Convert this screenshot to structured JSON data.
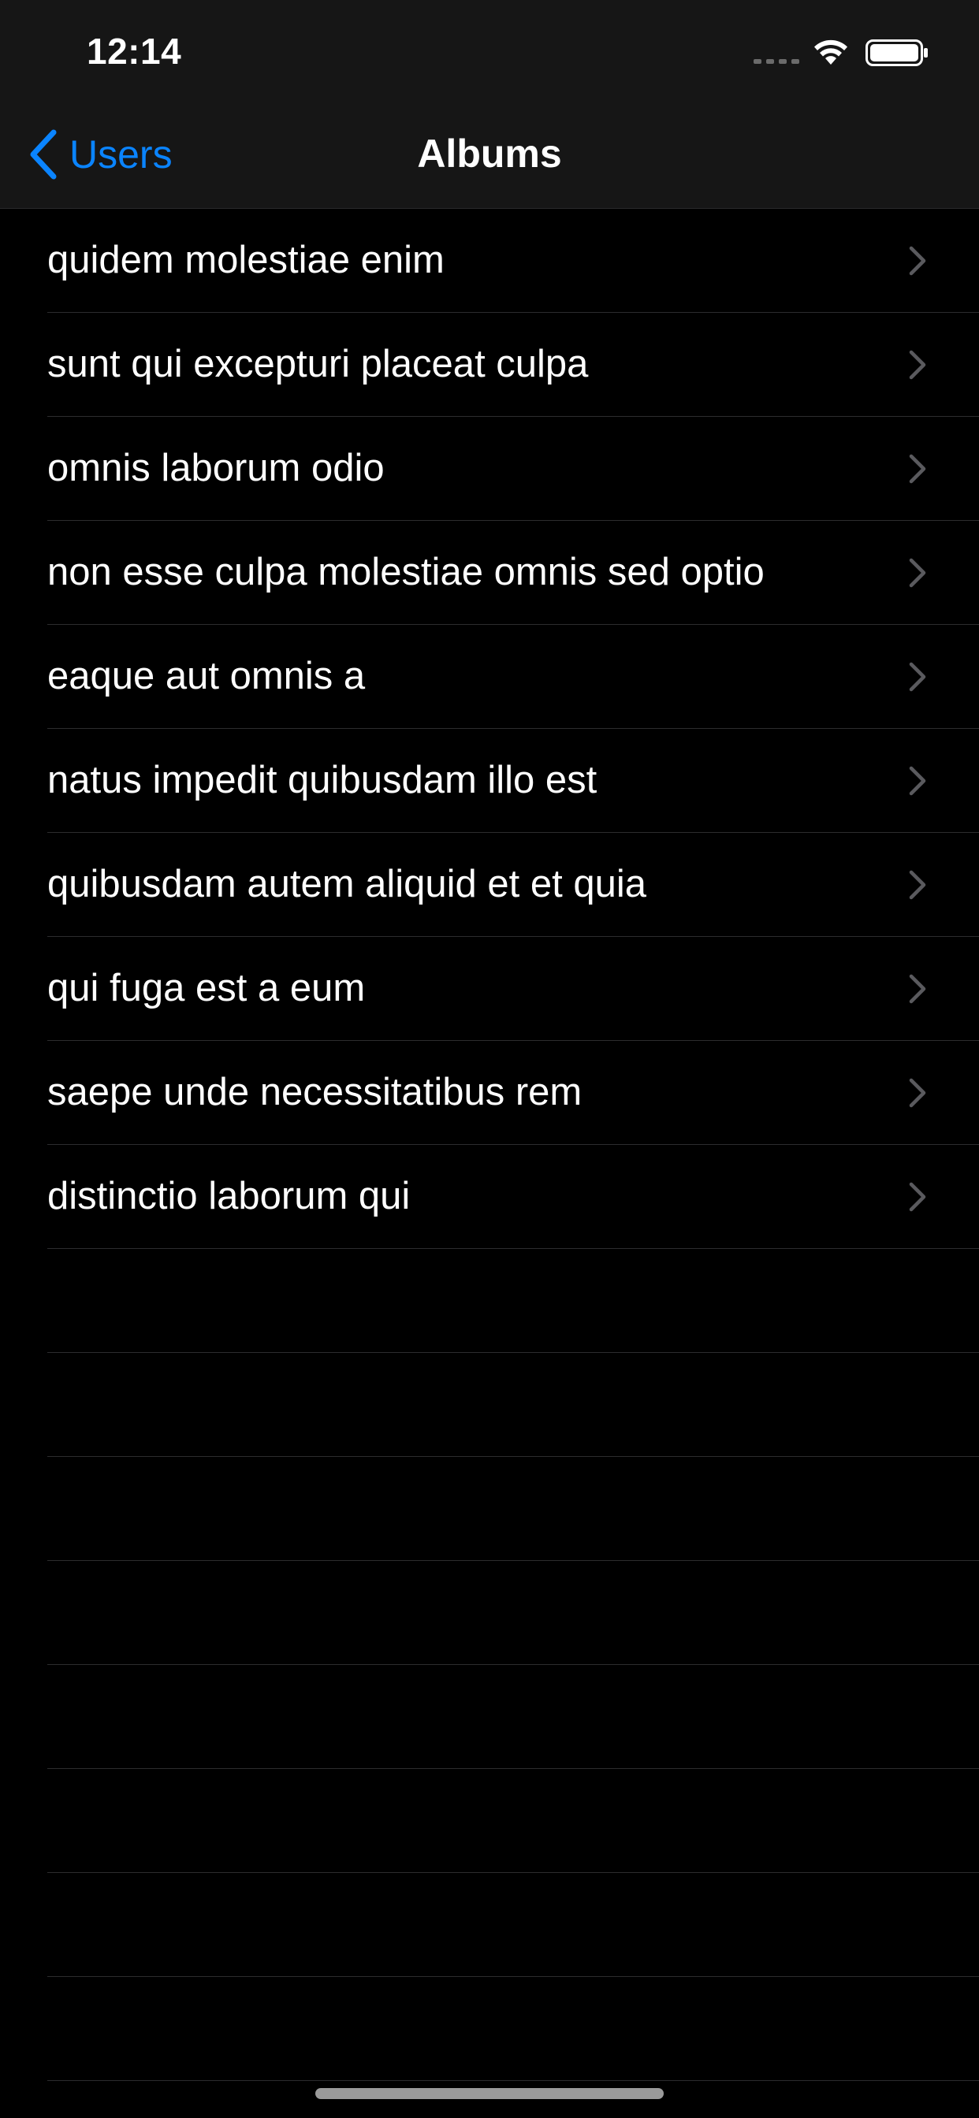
{
  "status_bar": {
    "time": "12:14"
  },
  "nav": {
    "back_label": "Users",
    "title": "Albums",
    "back_icon": "chevron-left-icon"
  },
  "colors": {
    "accent": "#0a84ff",
    "background": "#000000",
    "bar_background": "#161616",
    "separator": "#2c2c2e",
    "chevron": "#5a5a5e"
  },
  "albums": [
    {
      "title": "quidem molestiae enim"
    },
    {
      "title": "sunt qui excepturi placeat culpa"
    },
    {
      "title": "omnis laborum odio"
    },
    {
      "title": "non esse culpa molestiae omnis sed optio"
    },
    {
      "title": "eaque aut omnis a"
    },
    {
      "title": "natus impedit quibusdam illo est"
    },
    {
      "title": "quibusdam autem aliquid et et quia"
    },
    {
      "title": "qui fuga est a eum"
    },
    {
      "title": "saepe unde necessitatibus rem"
    },
    {
      "title": "distinctio laborum qui"
    }
  ]
}
